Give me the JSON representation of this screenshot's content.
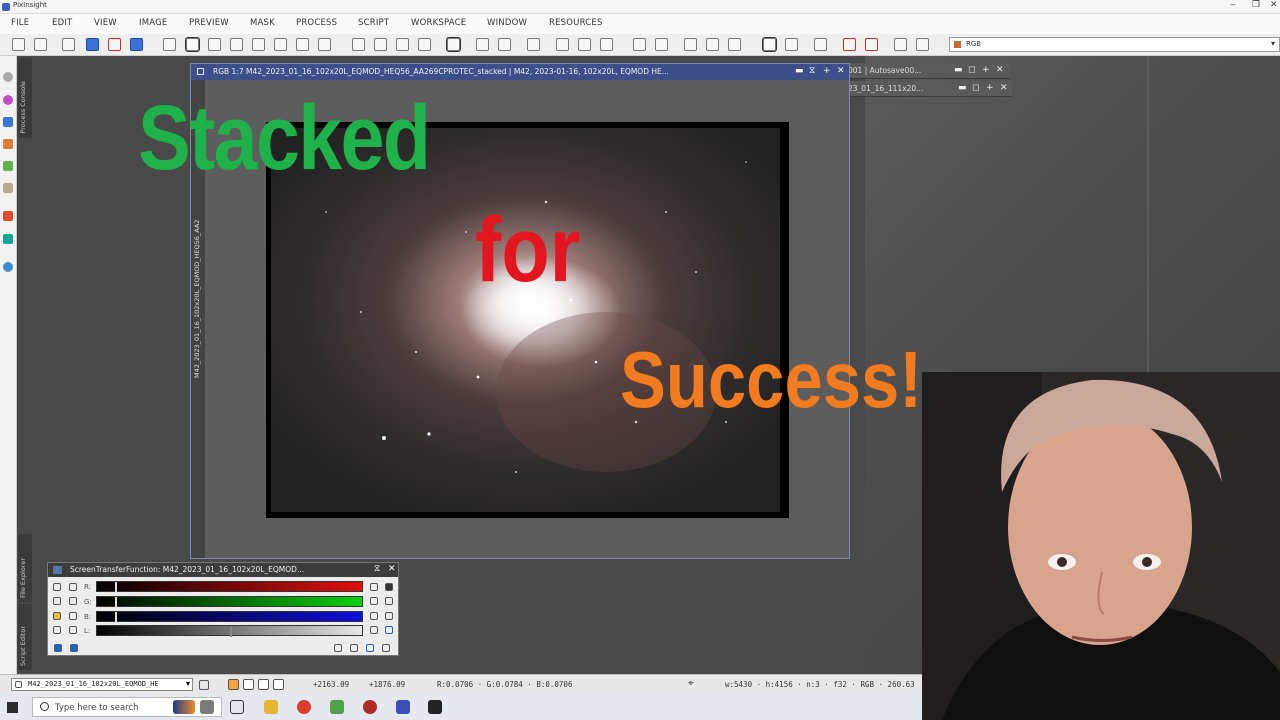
{
  "app": {
    "title": "PixInsight"
  },
  "menu": [
    "FILE",
    "EDIT",
    "VIEW",
    "IMAGE",
    "PREVIEW",
    "MASK",
    "PROCESS",
    "SCRIPT",
    "WORKSPACE",
    "WINDOW",
    "RESOURCES"
  ],
  "toolbar": {
    "channel_value": "RGB"
  },
  "side_tabs": {
    "process_console": "Process Console",
    "file_explorer": "File Explorer",
    "script_editor": "Script Editor"
  },
  "image_window": {
    "title": "RGB 1:7 M42_2023_01_16_102x20L_EQMOD_HEQ56_AA269CPROTEC_stacked | M42, 2023-01-16, 102x20L, EQMOD HE...",
    "side_label": "M42_2023_01_16_102x20L_EQMOD_HEQ56_AA2"
  },
  "background_windows": [
    "001 | Autosave00...",
    "23_01_16_111x20..."
  ],
  "stf_panel": {
    "title": "ScreenTransferFunction: M42_2023_01_16_102x20L_EQMOD...",
    "channels": [
      "R:",
      "G:",
      "B:",
      "L:"
    ]
  },
  "status": {
    "view_select": "M42_2023_01_16_102x20L_EQMOD_HE",
    "x_coord": "+2163.09",
    "y_coord": "+1876.09",
    "pixel_values": "R:0.0706 · G:0.0784 · B:0.0706",
    "image_info": "w:5430 · h:4156 · n:3 · f32 · RGB · 260.63"
  },
  "taskbar": {
    "search_placeholder": "Type here to search"
  },
  "overlay": {
    "line1": "Stacked",
    "line2": "for",
    "line3": "Success!"
  },
  "colors": {
    "stacked": "#1fb24a",
    "for": "#e31620",
    "success": "#f37b1f",
    "window_title": "#3c4f8a"
  }
}
